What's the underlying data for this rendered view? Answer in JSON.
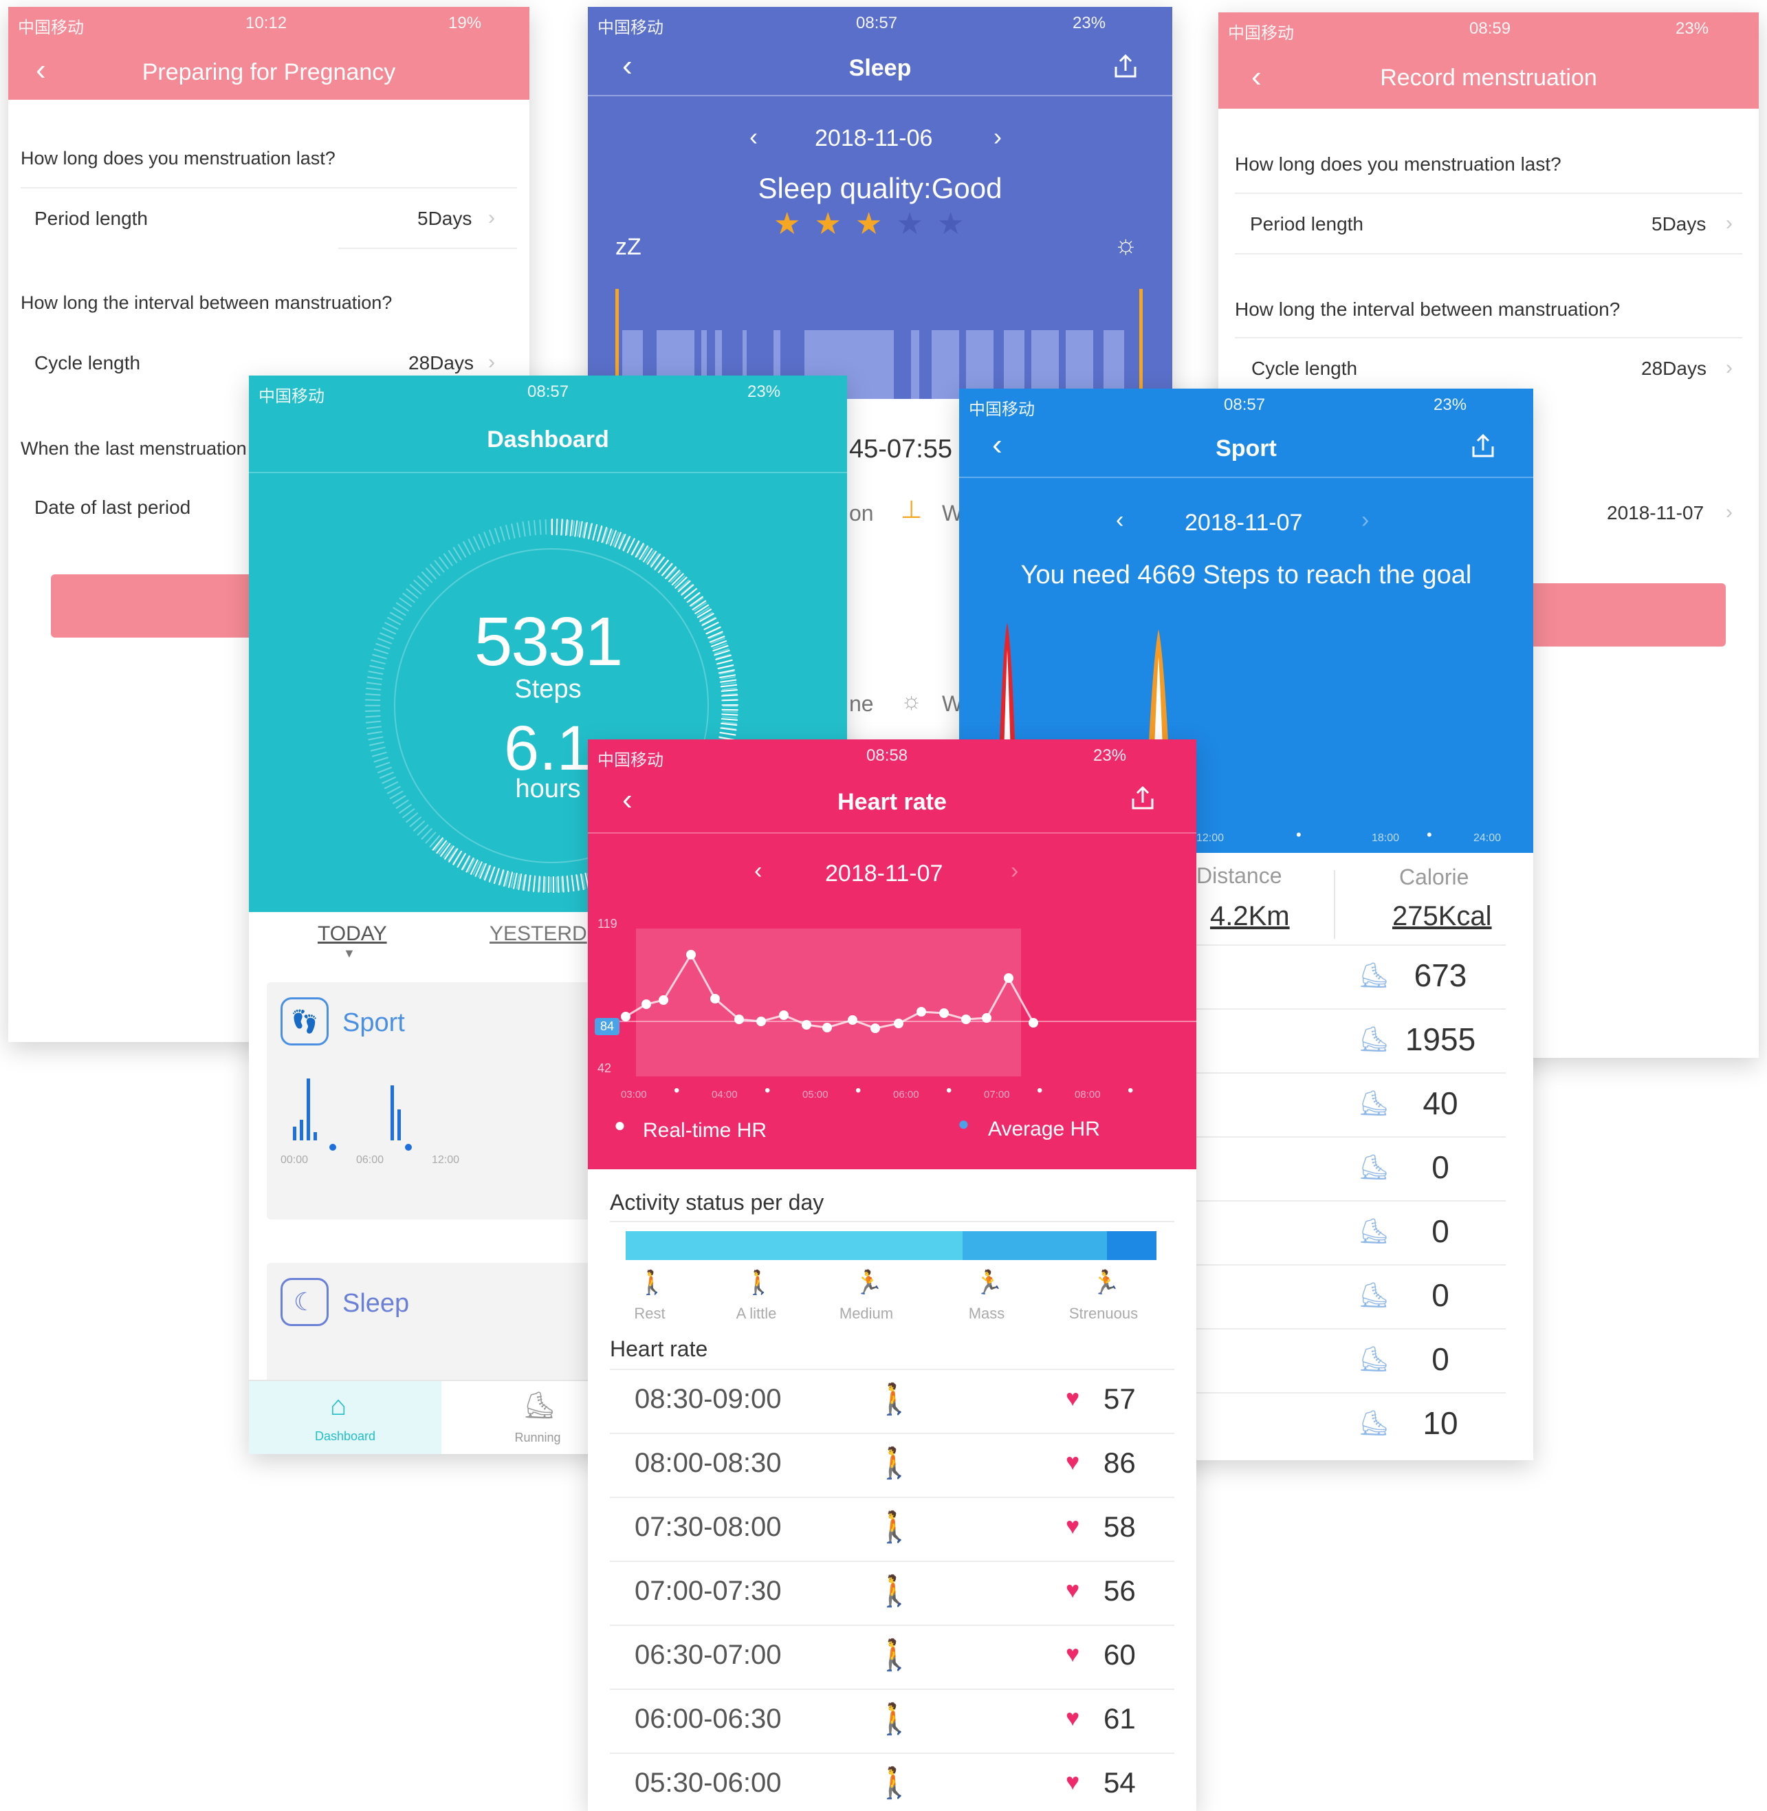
{
  "pregnancy": {
    "status": {
      "carrier": "中国移动",
      "time": "10:12",
      "battery": "19%"
    },
    "title": "Preparing for Pregnancy",
    "q1": "How long does you menstruation last?",
    "period_label": "Period length",
    "period_value": "5Days",
    "q2": "How long the interval between manstruation?",
    "cycle_label": "Cycle length",
    "cycle_value": "28Days",
    "q3": "When the last menstruation",
    "date_label": "Date of last period"
  },
  "sleep": {
    "status": {
      "carrier": "中国移动",
      "time": "08:57",
      "battery": "23%"
    },
    "title": "Sleep",
    "date": "2018-11-06",
    "quality": "Sleep quality:Good",
    "stars_filled": 3,
    "stars_total": 5,
    "zz": "zZ",
    "range": "45-07:55",
    "legend_a": "on",
    "legend_b": "W",
    "legend_c": "ne",
    "legend_d": "W"
  },
  "record": {
    "status": {
      "carrier": "中国移动",
      "time": "08:59",
      "battery": "23%"
    },
    "title": "Record menstruation",
    "q1": "How long does you menstruation last?",
    "period_label": "Period length",
    "period_value": "5Days",
    "q2": "How long the interval between manstruation?",
    "cycle_label": "Cycle length",
    "cycle_value": "28Days",
    "date_value": "2018-11-07"
  },
  "dashboard": {
    "status": {
      "carrier": "中国移动",
      "time": "08:57",
      "battery": "23%"
    },
    "title": "Dashboard",
    "steps": "5331",
    "steps_label": "Steps",
    "hours": "6.1",
    "hours_label": "hours",
    "tab_today": "TODAY",
    "tab_yesterday": "YESTERD",
    "sport_label": "Sport",
    "sleep_label": "Sleep",
    "nav_dashboard": "Dashboard",
    "nav_running": "Running",
    "mini_ticks": [
      "00:00",
      "06:00",
      "12:00"
    ]
  },
  "sport": {
    "status": {
      "carrier": "中国移动",
      "time": "08:57",
      "battery": "23%"
    },
    "title": "Sport",
    "date": "2018-11-07",
    "goal_text": "You need 4669 Steps to reach the goal",
    "ticks": [
      "12:00",
      "18:00",
      "24:00"
    ],
    "distance_label": "Distance",
    "distance_value": "4.2Km",
    "calorie_label": "Calorie",
    "calorie_value": "275Kcal",
    "rows": [
      "673",
      "1955",
      "40",
      "0",
      "0",
      "0",
      "0",
      "10"
    ]
  },
  "heart": {
    "status": {
      "carrier": "中国移动",
      "time": "08:58",
      "battery": "23%"
    },
    "title": "Heart rate",
    "date": "2018-11-07",
    "y_top": "119",
    "y_avg": "84",
    "y_bottom": "42",
    "x_ticks": [
      "03:00",
      "04:00",
      "05:00",
      "06:00",
      "07:00",
      "08:00"
    ],
    "legend_realtime": "Real-time HR",
    "legend_average": "Average HR",
    "activity_title": "Activity status per day",
    "activity_levels": [
      "Rest",
      "A little",
      "Medium",
      "Mass",
      "Strenuous"
    ],
    "hr_title": "Heart rate",
    "rows": [
      {
        "time": "08:30-09:00",
        "value": "57"
      },
      {
        "time": "08:00-08:30",
        "value": "86"
      },
      {
        "time": "07:30-08:00",
        "value": "58"
      },
      {
        "time": "07:00-07:30",
        "value": "56"
      },
      {
        "time": "06:30-07:00",
        "value": "60"
      },
      {
        "time": "06:00-06:30",
        "value": "61"
      },
      {
        "time": "05:30-06:00",
        "value": "54"
      }
    ]
  },
  "colors": {
    "pink_header": "#f48a96",
    "sleep_blue": "#5a6fc9",
    "teal": "#22bfcb",
    "sport_blue": "#1e88e5",
    "heart_pink": "#ef2a6b"
  }
}
